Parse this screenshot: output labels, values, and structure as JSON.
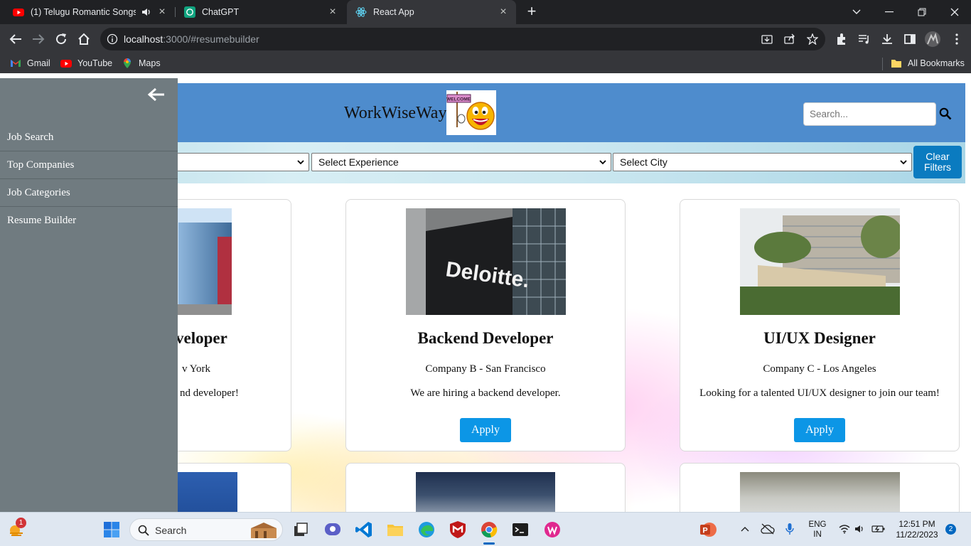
{
  "browser": {
    "tabs": [
      {
        "title": "(1) Telugu Romantic Songs |",
        "icon": "youtube-icon",
        "audio": true,
        "active": false
      },
      {
        "title": "ChatGPT",
        "icon": "chatgpt-icon",
        "active": false
      },
      {
        "title": "React App",
        "icon": "react-icon",
        "active": true
      }
    ],
    "url_host": "localhost",
    "url_path": ":3000/#resumebuilder",
    "bookmarks": [
      {
        "label": "Gmail",
        "icon": "gmail-icon"
      },
      {
        "label": "YouTube",
        "icon": "youtube-icon"
      },
      {
        "label": "Maps",
        "icon": "maps-icon"
      }
    ],
    "all_bookmarks": "All Bookmarks"
  },
  "app": {
    "brand": "WorkWiseWay",
    "logo_sign": "WELCOME",
    "search_placeholder": "Search...",
    "filters": {
      "experience": "Select Experience",
      "city": "Select City",
      "clear": "Clear Filters"
    },
    "sidebar": {
      "items": [
        "Job Search",
        "Top Companies",
        "Job Categories",
        "Resume Builder"
      ]
    },
    "jobs": [
      {
        "title": "Frontend Developer",
        "visible_title": "veloper",
        "visible_location": "v York",
        "visible_desc": "nd developer!",
        "image": "office-building"
      },
      {
        "title": "Backend Developer",
        "company": "Company B - San Francisco",
        "desc": "We are hiring a backend developer.",
        "apply": "Apply",
        "image": "deloitte-sign",
        "image_text": "Deloitte."
      },
      {
        "title": "UI/UX Designer",
        "company": "Company C - Los Angeles",
        "desc": "Looking for a talented UI/UX designer to join our team!",
        "apply": "Apply",
        "image": "tcs-building"
      }
    ]
  },
  "taskbar": {
    "search_label": "Search",
    "weather_badge": "1",
    "lang_line1": "ENG",
    "lang_line2": "IN",
    "time": "12:51 PM",
    "date": "11/22/2023",
    "notifications": "2"
  },
  "colors": {
    "header": "#4e8ccd",
    "sidebar": "#707b80",
    "apply_button": "#0c96e6",
    "clear_button": "#0a7bc0"
  }
}
